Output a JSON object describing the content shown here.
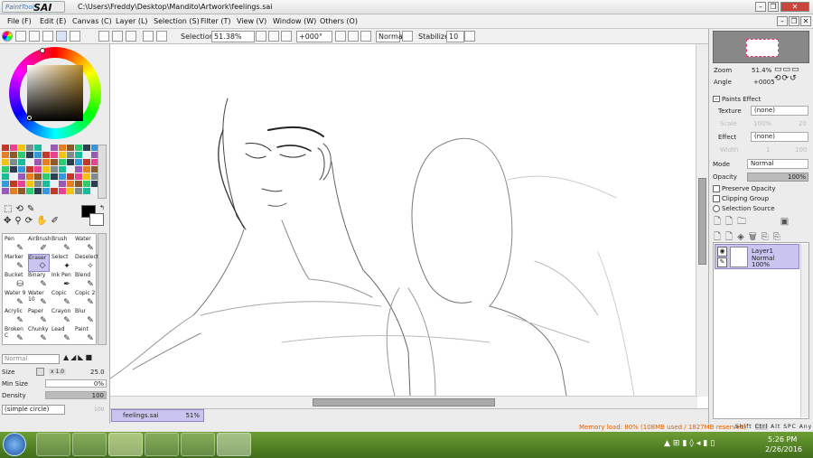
{
  "window": {
    "logo_small": "PaintTool",
    "logo_big": "SAI",
    "title": "C:\\Users\\Freddy\\Desktop\\Mandito\\Artwork\\feelings.sai"
  },
  "menu": [
    "File (F)",
    "Edit (E)",
    "Canvas (C)",
    "Layer (L)",
    "Selection (S)",
    "Filter (T)",
    "View (V)",
    "Window (W)",
    "Others (O)"
  ],
  "toolbar": {
    "selection_label": "Selection",
    "zoom": "51.38%",
    "angle": "+000°",
    "mode": "Normal",
    "stabilizer_label": "Stabilizer",
    "stabilizer": "10"
  },
  "tools": [
    {
      "name": "Pen",
      "icon": "✎"
    },
    {
      "name": "AirBrush",
      "icon": "✐"
    },
    {
      "name": "Brush",
      "icon": "✎"
    },
    {
      "name": "Water",
      "icon": "✎"
    },
    {
      "name": "Marker",
      "icon": "✎"
    },
    {
      "name": "Eraser",
      "icon": "◇"
    },
    {
      "name": "Select",
      "icon": "✦"
    },
    {
      "name": "Deselect",
      "icon": "✧"
    },
    {
      "name": "Bucket",
      "icon": "⛁"
    },
    {
      "name": "Binary",
      "icon": "✎"
    },
    {
      "name": "Ink Pen",
      "icon": "✒"
    },
    {
      "name": "Blend",
      "icon": "✎"
    },
    {
      "name": "Water 9",
      "icon": "✎"
    },
    {
      "name": "Water 10",
      "icon": "✎"
    },
    {
      "name": "Copic",
      "icon": "✎"
    },
    {
      "name": "Copic 2",
      "icon": "✎"
    },
    {
      "name": "Acrylic",
      "icon": "✎"
    },
    {
      "name": "Paper",
      "icon": "✎"
    },
    {
      "name": "Crayon",
      "icon": "✎"
    },
    {
      "name": "Blur",
      "icon": "✎"
    },
    {
      "name": "Broken C",
      "icon": "✎"
    },
    {
      "name": "Chunky",
      "icon": "✎"
    },
    {
      "name": "Lead",
      "icon": "✎"
    },
    {
      "name": "Paint",
      "icon": "✎"
    }
  ],
  "brush": {
    "mode": "Normal",
    "size_label": "Size",
    "size_mult": "x 1.0",
    "size": "25.0",
    "minsize_label": "Min Size",
    "minsize": "0%",
    "density_label": "Density",
    "density": "100",
    "shape": "(simple circle)",
    "shape_value": "100",
    "density_fill": 1.0
  },
  "navigator": {
    "zoom_label": "Zoom",
    "zoom": "51.4%",
    "angle_label": "Angle",
    "angle": "+0005"
  },
  "paints_effect": {
    "header": "Paints Effect",
    "texture_label": "Texture",
    "texture": "(none)",
    "scale_label": "Scale",
    "scale": "100%",
    "scale_val2": "20",
    "effect_label": "Effect",
    "effect": "(none)",
    "width_label": "Width",
    "width": "1",
    "width_val2": "100"
  },
  "layer_props": {
    "mode_label": "Mode",
    "mode": "Normal",
    "opacity_label": "Opacity",
    "opacity": "100%",
    "preserve": "Preserve Opacity",
    "clipping": "Clipping Group",
    "selsource": "Selection Source"
  },
  "layers": [
    {
      "name": "Layer1",
      "mode": "Normal",
      "opacity": "100%"
    }
  ],
  "document": {
    "name": "feelings.sai",
    "zoom": "51%"
  },
  "status": {
    "memory": "Memory load: 80% (108MB used / 1827MB reserved)",
    "keys": [
      "Shift",
      "Ctrl",
      "Alt",
      "SPC",
      "Any"
    ]
  },
  "taskbar": {
    "time": "5:26 PM",
    "date": "2/26/2016"
  },
  "colors": {
    "primary": "#000000",
    "secondary": "#ffffff",
    "layer_selected": "#c9c4f0",
    "memory_text": "#e06000",
    "taskbar": "#4f7d22"
  }
}
